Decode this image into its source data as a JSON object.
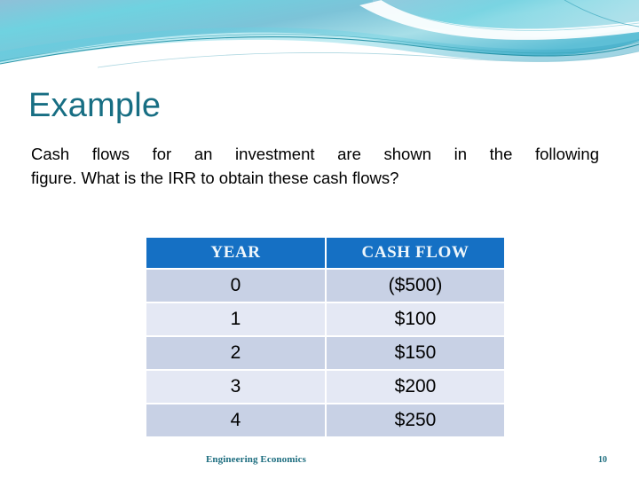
{
  "slide": {
    "title": "Example",
    "body_line_1": "Cash flows  for an investment are shown in the following",
    "body_line_2": "figure. What is the IRR to obtain these cash flows?",
    "footer_note": "Engineering Economics",
    "page_number": "10"
  },
  "table": {
    "headers": [
      "YEAR",
      "CASH  FLOW"
    ],
    "rows": [
      {
        "year": "0",
        "cash_flow": "($500)"
      },
      {
        "year": "1",
        "cash_flow": "$100"
      },
      {
        "year": "2",
        "cash_flow": "$150"
      },
      {
        "year": "3",
        "cash_flow": "$200"
      },
      {
        "year": "4",
        "cash_flow": "$250"
      }
    ]
  },
  "theme": {
    "title_color": "#176e83",
    "table_header_bg": "#1570c4",
    "table_header_text": "#eef6fb",
    "row_band_dark": "#c8d1e5",
    "row_band_light": "#e4e8f4",
    "banner_cyan": "#5ad6e3",
    "banner_blue": "#8fc0d8",
    "footer_color": "#1b6c7e"
  }
}
